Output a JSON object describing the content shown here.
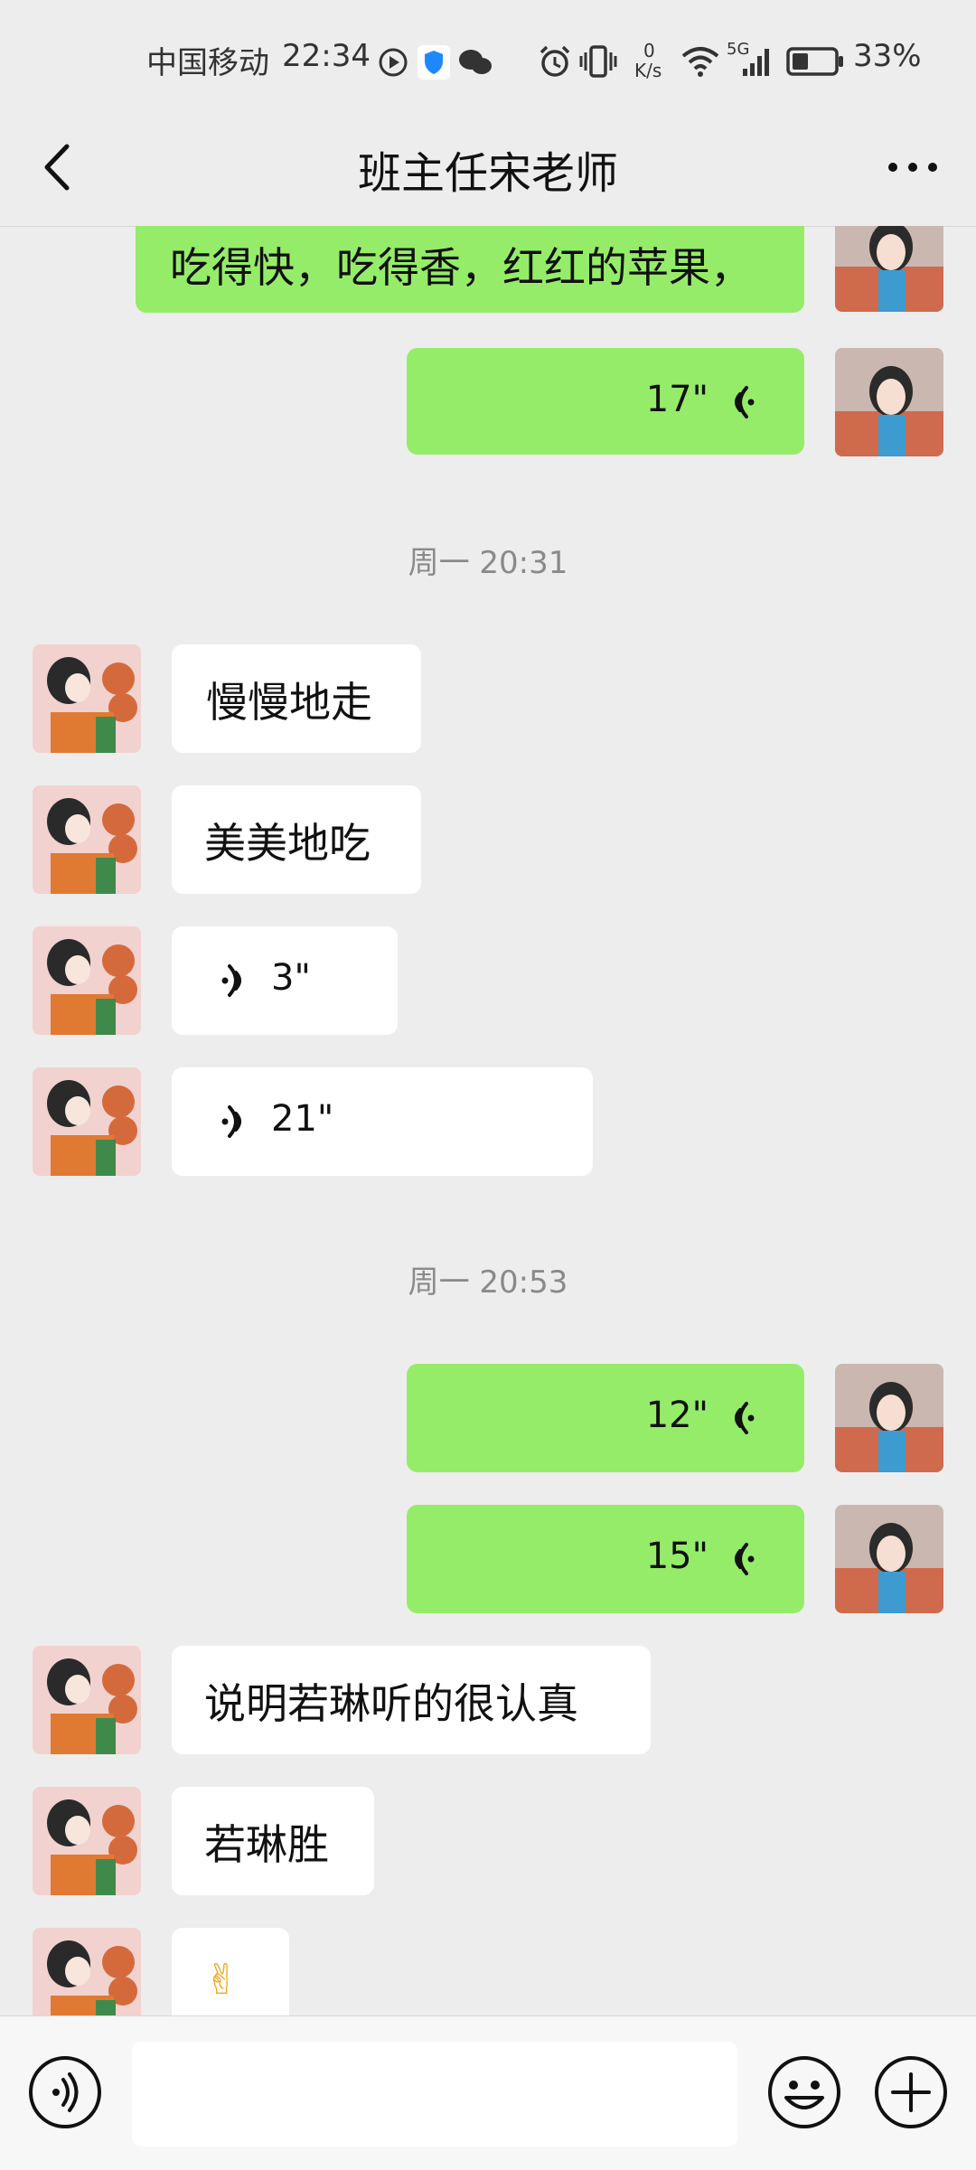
{
  "status_bar": {
    "carrier": "中国移动",
    "time": "22:34",
    "net_speed_top": "0",
    "net_speed_bottom": "K/s",
    "signal": "5G",
    "battery": "33%"
  },
  "header": {
    "title": "班主任宋老师"
  },
  "messages": [
    {
      "kind": "text",
      "side": "out",
      "text": "吃得快，吃得香，红红的苹果，"
    },
    {
      "kind": "voice",
      "side": "out",
      "duration": "17\""
    },
    {
      "kind": "time",
      "text": "周一 20:31"
    },
    {
      "kind": "text",
      "side": "in",
      "text": "慢慢地走"
    },
    {
      "kind": "text",
      "side": "in",
      "text": "美美地吃"
    },
    {
      "kind": "voice",
      "side": "in",
      "duration": "3\""
    },
    {
      "kind": "voice",
      "side": "in",
      "duration": "21\""
    },
    {
      "kind": "time",
      "text": "周一 20:53"
    },
    {
      "kind": "voice",
      "side": "out",
      "duration": "12\""
    },
    {
      "kind": "voice",
      "side": "out",
      "duration": "15\""
    },
    {
      "kind": "text",
      "side": "in",
      "text": "说明若琳听的很认真"
    },
    {
      "kind": "text",
      "side": "in",
      "text": "若琳胜"
    },
    {
      "kind": "text",
      "side": "in",
      "text": "✌"
    }
  ],
  "colors": {
    "background": "#ededed",
    "outgoing_bubble": "#95ec69",
    "incoming_bubble": "#ffffff"
  },
  "icons": [
    "back-chevron-icon",
    "more-icon",
    "voice-input-icon",
    "emoji-icon",
    "plus-icon",
    "voice-wave-icon"
  ]
}
